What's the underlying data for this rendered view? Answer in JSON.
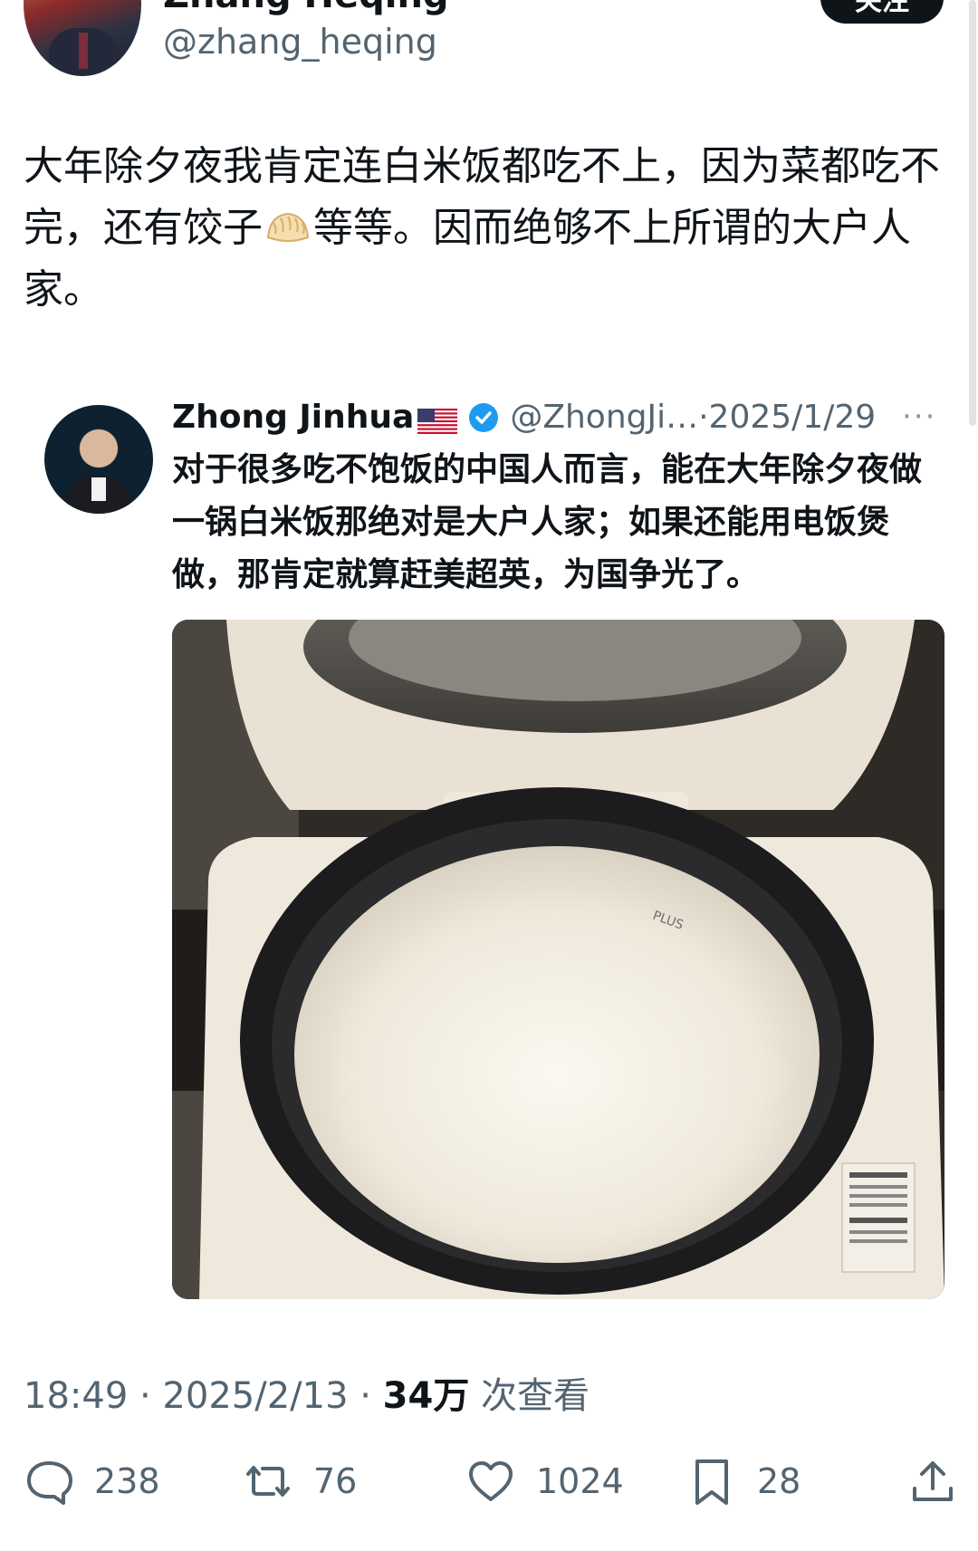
{
  "author": {
    "display_name": "Zhang Heqing",
    "handle": "@zhang_heqing",
    "follow_label": "关注"
  },
  "tweet": {
    "text_part1": "大年除夕夜我肯定连白米饭都吃不上，因为菜都吃不完，还有饺子",
    "text_part2": "等等。因而绝够不上所谓的大户人家。"
  },
  "quoted_tweet": {
    "display_name": "Zhong Jinhua",
    "handle_and_date": "@ZhongJi…·2025/1/29",
    "more_label": "···",
    "text": "对于很多吃不饱饭的中国人而言，能在大年除夕夜做一锅白米饭那绝对是大户人家；如果还能用电饭煲做，那肯定就算赶美超英，为国争光了。",
    "photo_label_small": "PLUS"
  },
  "meta": {
    "time_date": "18:49 · 2025/2/13 · ",
    "views": "34万",
    "views_label": " 次查看"
  },
  "actions": {
    "replies": "238",
    "reposts": "76",
    "likes": "1024",
    "bookmarks": "28"
  },
  "icons": [
    "dumpling-icon",
    "us-flag-icon",
    "verified-icon",
    "reply-icon",
    "repost-icon",
    "like-icon",
    "bookmark-icon",
    "share-icon"
  ],
  "colors": {
    "text": "#0f1419",
    "secondary": "#536471",
    "verified": "#1d9bf0",
    "follow_bg": "#0f1419"
  }
}
